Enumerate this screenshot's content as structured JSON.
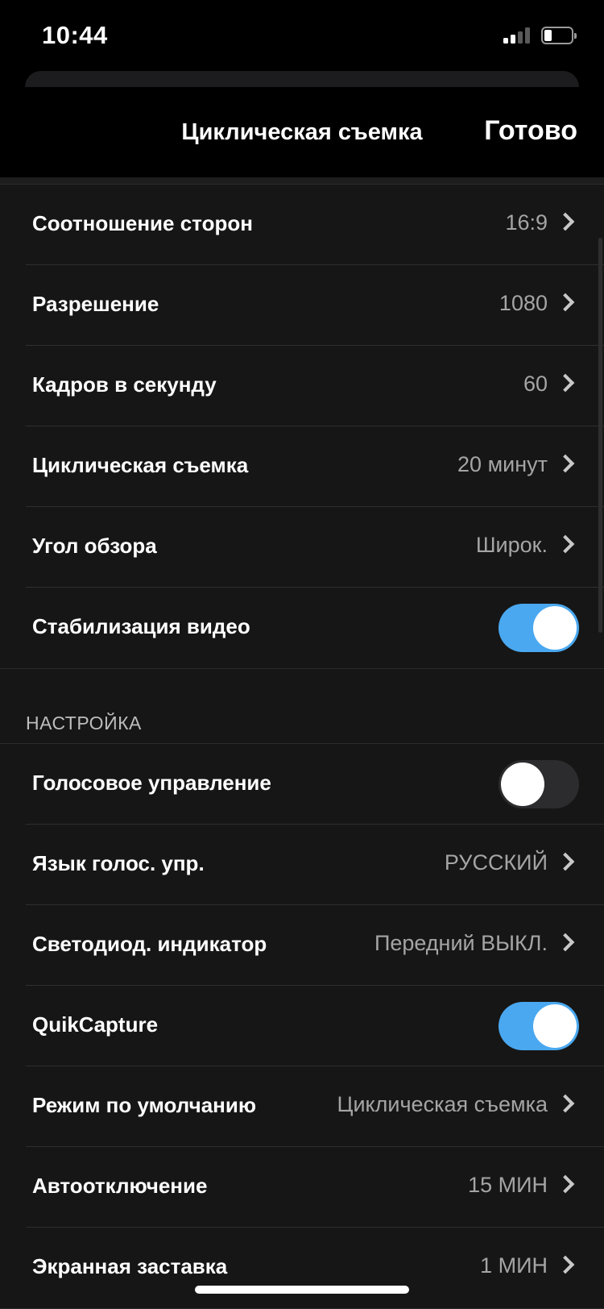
{
  "status_bar": {
    "time": "10:44"
  },
  "nav": {
    "title": "Циклическая съемка",
    "done_label": "Готово"
  },
  "video_settings": [
    {
      "label": "Соотношение сторон",
      "value": "16:9",
      "type": "link"
    },
    {
      "label": "Разрешение",
      "value": "1080",
      "type": "link"
    },
    {
      "label": "Кадров в секунду",
      "value": "60",
      "type": "link"
    },
    {
      "label": "Циклическая съемка",
      "value": "20 минут",
      "type": "link"
    },
    {
      "label": "Угол обзора",
      "value": "Широк.",
      "type": "link"
    },
    {
      "label": "Стабилизация видео",
      "type": "toggle",
      "on": true
    }
  ],
  "setup_section": {
    "header": "НАСТРОЙКА",
    "items": [
      {
        "label": "Голосовое управление",
        "type": "toggle",
        "on": false
      },
      {
        "label": "Язык голос. упр.",
        "value": "РУССКИЙ",
        "type": "link"
      },
      {
        "label": "Светодиод. индикатор",
        "value": "Передний ВЫКЛ.",
        "type": "link"
      },
      {
        "label": "QuikCapture",
        "type": "toggle",
        "on": true
      },
      {
        "label": "Режим по умолчанию",
        "value": "Циклическая съемка",
        "type": "link"
      },
      {
        "label": "Автоотключение",
        "value": "15 МИН",
        "type": "link"
      },
      {
        "label": "Экранная заставка",
        "value": "1 МИН",
        "type": "link"
      }
    ]
  },
  "colors": {
    "accent": "#4aa8f0",
    "background": "#161616",
    "value_text": "#a5a5a5"
  }
}
